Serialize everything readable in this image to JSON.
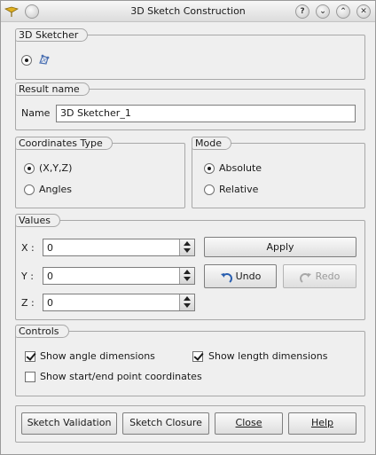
{
  "window": {
    "title": "3D Sketch Construction",
    "icons": [
      "app-logo-icon",
      "minimize-circle-icon",
      "help-icon",
      "shade-down-icon",
      "shade-up-icon",
      "close-icon"
    ],
    "help_glyph": "?",
    "down_glyph": "⌄",
    "up_glyph": "⌃",
    "close_glyph": "✕"
  },
  "sketcher": {
    "label": "3D Sketcher",
    "selected": true,
    "icon": "3d-sketch-icon"
  },
  "result": {
    "label": "Result name",
    "name_label": "Name",
    "name_value": "3D Sketcher_1"
  },
  "coordinates_type": {
    "label": "Coordinates Type",
    "options": [
      {
        "label": "(X,Y,Z)",
        "selected": true
      },
      {
        "label": "Angles",
        "selected": false
      }
    ]
  },
  "mode": {
    "label": "Mode",
    "options": [
      {
        "label": "Absolute",
        "selected": true
      },
      {
        "label": "Relative",
        "selected": false
      }
    ]
  },
  "values": {
    "label": "Values",
    "x_label": "X :",
    "x_value": "0",
    "y_label": "Y :",
    "y_value": "0",
    "z_label": "Z :",
    "z_value": "0",
    "apply": "Apply",
    "undo": "Undo",
    "redo": "Redo",
    "undo_icon": "undo-arrow-icon",
    "redo_icon": "redo-arrow-icon"
  },
  "controls": {
    "label": "Controls",
    "show_angle": {
      "label": "Show angle dimensions",
      "checked": true
    },
    "show_length": {
      "label": "Show length dimensions",
      "checked": true
    },
    "show_coords": {
      "label": "Show start/end point coordinates",
      "checked": false
    }
  },
  "footer": {
    "sketch_validation": "Sketch Validation",
    "sketch_closure": "Sketch Closure",
    "close": "Close",
    "help": "Help"
  },
  "colors": {
    "window_bg": "#efefef",
    "undo_icon": "#2a5fb0",
    "disabled_text": "#9a9a9a"
  }
}
